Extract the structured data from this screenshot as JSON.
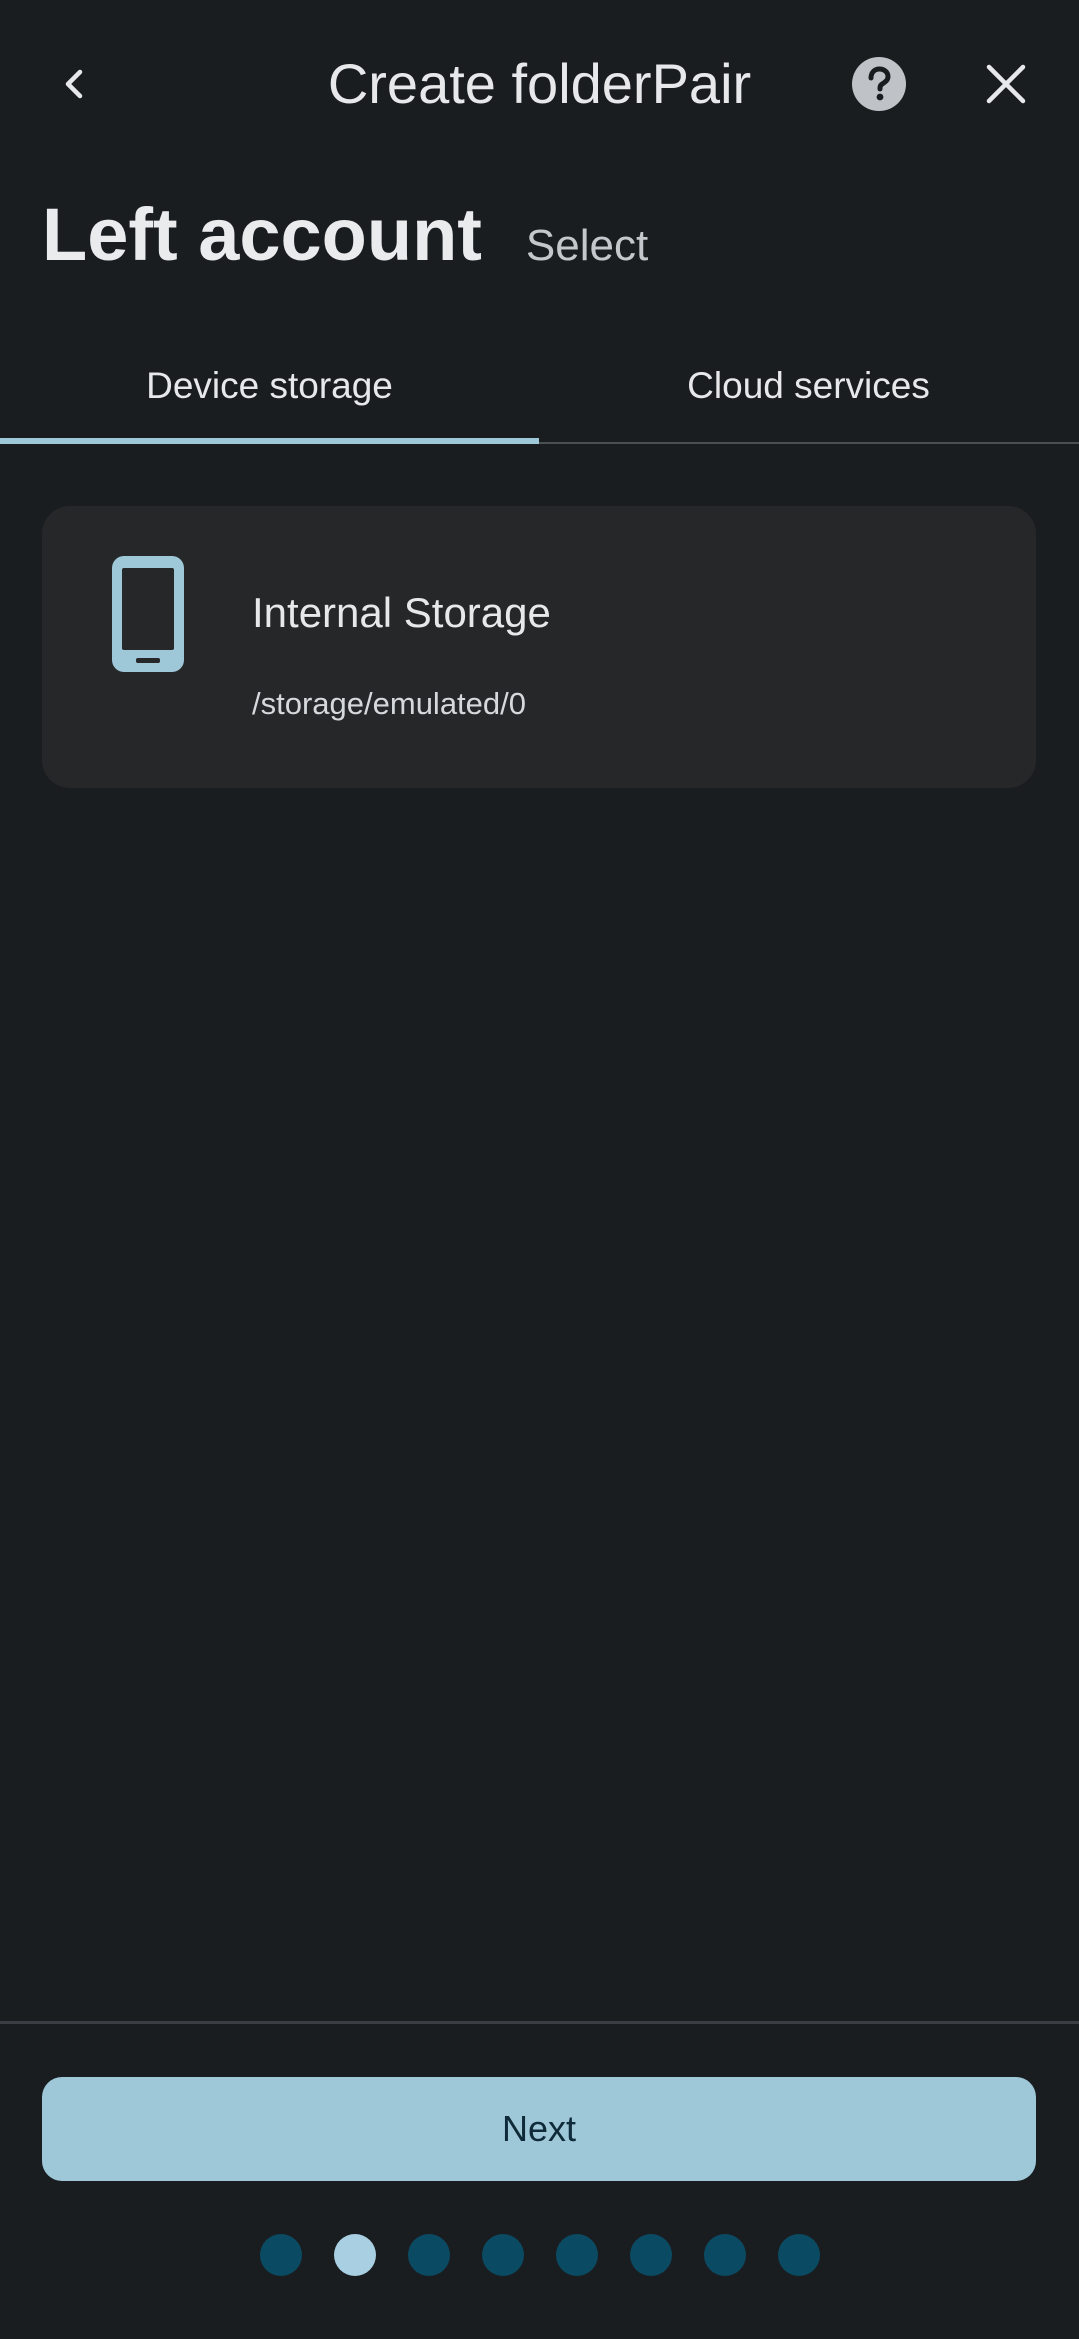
{
  "header": {
    "title": "Create folderPair",
    "back_icon": "chevron-left-icon",
    "help_icon": "help-circle-icon",
    "close_icon": "close-icon"
  },
  "section": {
    "title": "Left account",
    "subtitle": "Select"
  },
  "tabs": [
    {
      "label": "Device storage",
      "active": true
    },
    {
      "label": "Cloud services",
      "active": false
    }
  ],
  "storage_list": [
    {
      "icon": "smartphone-icon",
      "title": "Internal Storage",
      "path": "/storage/emulated/0"
    }
  ],
  "footer": {
    "next_label": "Next",
    "step_count": 8,
    "current_step": 2
  },
  "colors": {
    "background": "#1a1d20",
    "accent": "#9ec7d8",
    "card": "#262728",
    "dot_inactive": "#0b4a63",
    "dot_active": "#a9d0e2"
  }
}
